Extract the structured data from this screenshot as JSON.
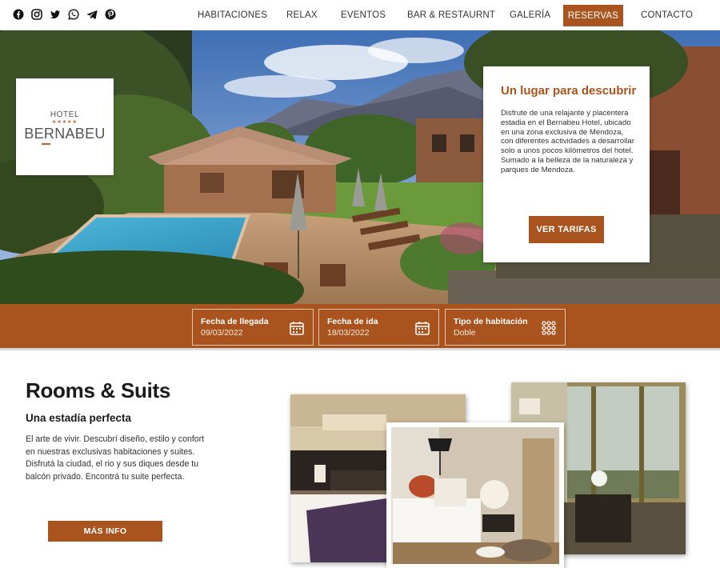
{
  "social": {
    "icons": [
      "facebook-icon",
      "instagram-icon",
      "twitter-icon",
      "whatsapp-icon",
      "telegram-icon",
      "pinterest-icon"
    ]
  },
  "nav": {
    "items": [
      "HABITACIONES",
      "RELAX",
      "EVENTOS",
      "BAR & RESTAURNT",
      "GALERÍA"
    ],
    "cta": "RESERVAS",
    "last": "CONTACTO"
  },
  "logo": {
    "hotel": "HOTEL",
    "stars": "★★★★★",
    "name": "BERNABEU"
  },
  "hero_card": {
    "title": "Un lugar para descubrir",
    "text": "Disfrute de una relajante y placentera estadia en el Bernabeu Hotel, ubicado en una zona exclusiva de Mendoza, con diferentes actividades a desarrollar solo a unos pocos kilómetros del hotel. Sumado a la belleza de la naturaleza y parques de Mendoza.",
    "button": "VER TARIFAS"
  },
  "booking": {
    "arrival_label": "Fecha de llegada",
    "arrival_value": "09/03/2022",
    "departure_label": "Fecha de ida",
    "departure_value": "18/03/2022",
    "room_label": "Tipo de habitación",
    "room_value": "Doble"
  },
  "rooms": {
    "title": "Rooms & Suits",
    "subtitle": "Una estadía perfecta",
    "text": "El arte de vivir. Descubrí diseño, estilo y confort en nuestras exclusivas habitaciones y suites. Disfrutá la ciudad, el rio y sus diques desde tu balcón privado. Encontrá tu suite perfecta.",
    "button": "MÁS INFO"
  },
  "colors": {
    "brand": "#a9541e",
    "text_dark": "#1a1a1a"
  }
}
